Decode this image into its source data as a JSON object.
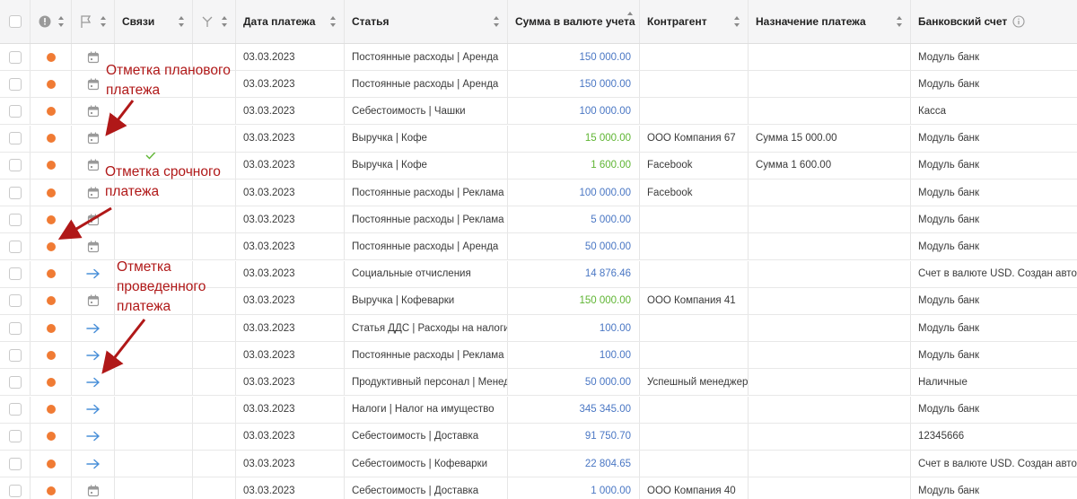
{
  "columns": {
    "links": "Связи",
    "date": "Дата платежа",
    "article": "Статья",
    "sum": "Сумма в валюте учета",
    "counterparty": "Контрагент",
    "purpose": "Назначение платежа",
    "bank": "Банковский счет"
  },
  "rows": [
    {
      "type": "calendar-icon",
      "date": "03.03.2023",
      "article": "Постоянные расходы | Аренда",
      "sum": "150 000.00",
      "sum_color": "blue",
      "counterparty": "",
      "purpose": "",
      "bank": "Модуль банк"
    },
    {
      "type": "calendar-icon",
      "date": "03.03.2023",
      "article": "Постоянные расходы | Аренда",
      "sum": "150 000.00",
      "sum_color": "blue",
      "counterparty": "",
      "purpose": "",
      "bank": "Модуль банк"
    },
    {
      "type": "calendar-icon",
      "date": "03.03.2023",
      "article": "Себестоимость | Чашки",
      "sum": "100 000.00",
      "sum_color": "blue",
      "counterparty": "",
      "purpose": "",
      "bank": "Касса"
    },
    {
      "type": "calendar-icon",
      "date": "03.03.2023",
      "article": "Выручка | Кофе",
      "sum": "15 000.00",
      "sum_color": "green",
      "counterparty": "ООО Компания 67",
      "purpose": "Сумма 15 000.00",
      "bank": "Модуль банк"
    },
    {
      "type": "calendar-icon",
      "date": "03.03.2023",
      "article": "Выручка | Кофе",
      "sum": "1 600.00",
      "sum_color": "green",
      "counterparty": "Facebook",
      "purpose": "Сумма 1 600.00",
      "bank": "Модуль банк",
      "check": true
    },
    {
      "type": "calendar-icon",
      "date": "03.03.2023",
      "article": "Постоянные расходы | Реклама",
      "sum": "100 000.00",
      "sum_color": "blue",
      "counterparty": "Facebook",
      "purpose": "",
      "bank": "Модуль банк"
    },
    {
      "type": "calendar-icon",
      "date": "03.03.2023",
      "article": "Постоянные расходы | Реклама",
      "sum": "5 000.00",
      "sum_color": "blue",
      "counterparty": "",
      "purpose": "",
      "bank": "Модуль банк"
    },
    {
      "type": "calendar-icon",
      "date": "03.03.2023",
      "article": "Постоянные расходы | Аренда",
      "sum": "50 000.00",
      "sum_color": "blue",
      "counterparty": "",
      "purpose": "",
      "bank": "Модуль банк"
    },
    {
      "type": "arrow-right-icon",
      "date": "03.03.2023",
      "article": "Социальные отчисления",
      "sum": "14 876.46",
      "sum_color": "blue",
      "counterparty": "",
      "purpose": "",
      "bank": "Счет в валюте USD. Создан автом"
    },
    {
      "type": "calendar-icon",
      "date": "03.03.2023",
      "article": "Выручка | Кофеварки",
      "sum": "150 000.00",
      "sum_color": "green",
      "counterparty": "ООО Компания 41",
      "purpose": "",
      "bank": "Модуль банк"
    },
    {
      "type": "arrow-right-icon",
      "date": "03.03.2023",
      "article": "Статья ДДС | Расходы на налоги",
      "sum": "100.00",
      "sum_color": "blue",
      "counterparty": "",
      "purpose": "",
      "bank": "Модуль банк"
    },
    {
      "type": "arrow-right-icon",
      "date": "03.03.2023",
      "article": "Постоянные расходы | Реклама",
      "sum": "100.00",
      "sum_color": "blue",
      "counterparty": "",
      "purpose": "",
      "bank": "Модуль банк"
    },
    {
      "type": "arrow-right-icon",
      "date": "03.03.2023",
      "article": "Продуктивный персонал | Менеджер",
      "sum": "50 000.00",
      "sum_color": "blue",
      "counterparty": "Успешный менеджер",
      "purpose": "",
      "bank": "Наличные"
    },
    {
      "type": "arrow-right-icon",
      "date": "03.03.2023",
      "article": "Налоги | Налог на имущество",
      "sum": "345 345.00",
      "sum_color": "blue",
      "counterparty": "",
      "purpose": "",
      "bank": "Модуль банк"
    },
    {
      "type": "arrow-right-icon",
      "date": "03.03.2023",
      "article": "Себестоимость | Доставка",
      "sum": "91 750.70",
      "sum_color": "blue",
      "counterparty": "",
      "purpose": "",
      "bank": "12345666"
    },
    {
      "type": "arrow-right-icon",
      "date": "03.03.2023",
      "article": "Себестоимость | Кофеварки",
      "sum": "22 804.65",
      "sum_color": "blue",
      "counterparty": "",
      "purpose": "",
      "bank": "Счет в валюте USD. Создан автом"
    },
    {
      "type": "calendar-icon",
      "date": "03.03.2023",
      "article": "Себестоимость | Доставка",
      "sum": "1 000.00",
      "sum_color": "blue",
      "counterparty": "ООО Компания 40",
      "purpose": "",
      "bank": "Модуль банк"
    }
  ],
  "annotations": {
    "planned": "Отметка планового платежа",
    "planned_l1": "Отметка планового",
    "planned_l2": "платежа",
    "urgent_l1": "Отметка срочного",
    "urgent_l2": "платежа",
    "done_l1": "Отметка",
    "done_l2": "проведенного",
    "done_l3": "платежа"
  },
  "colors": {
    "status_dot": "#f07b34",
    "sum_blue": "#4a77c4",
    "sum_green": "#5fb533",
    "annotation": "#b01818",
    "arrow_icon": "#4a90d9"
  }
}
